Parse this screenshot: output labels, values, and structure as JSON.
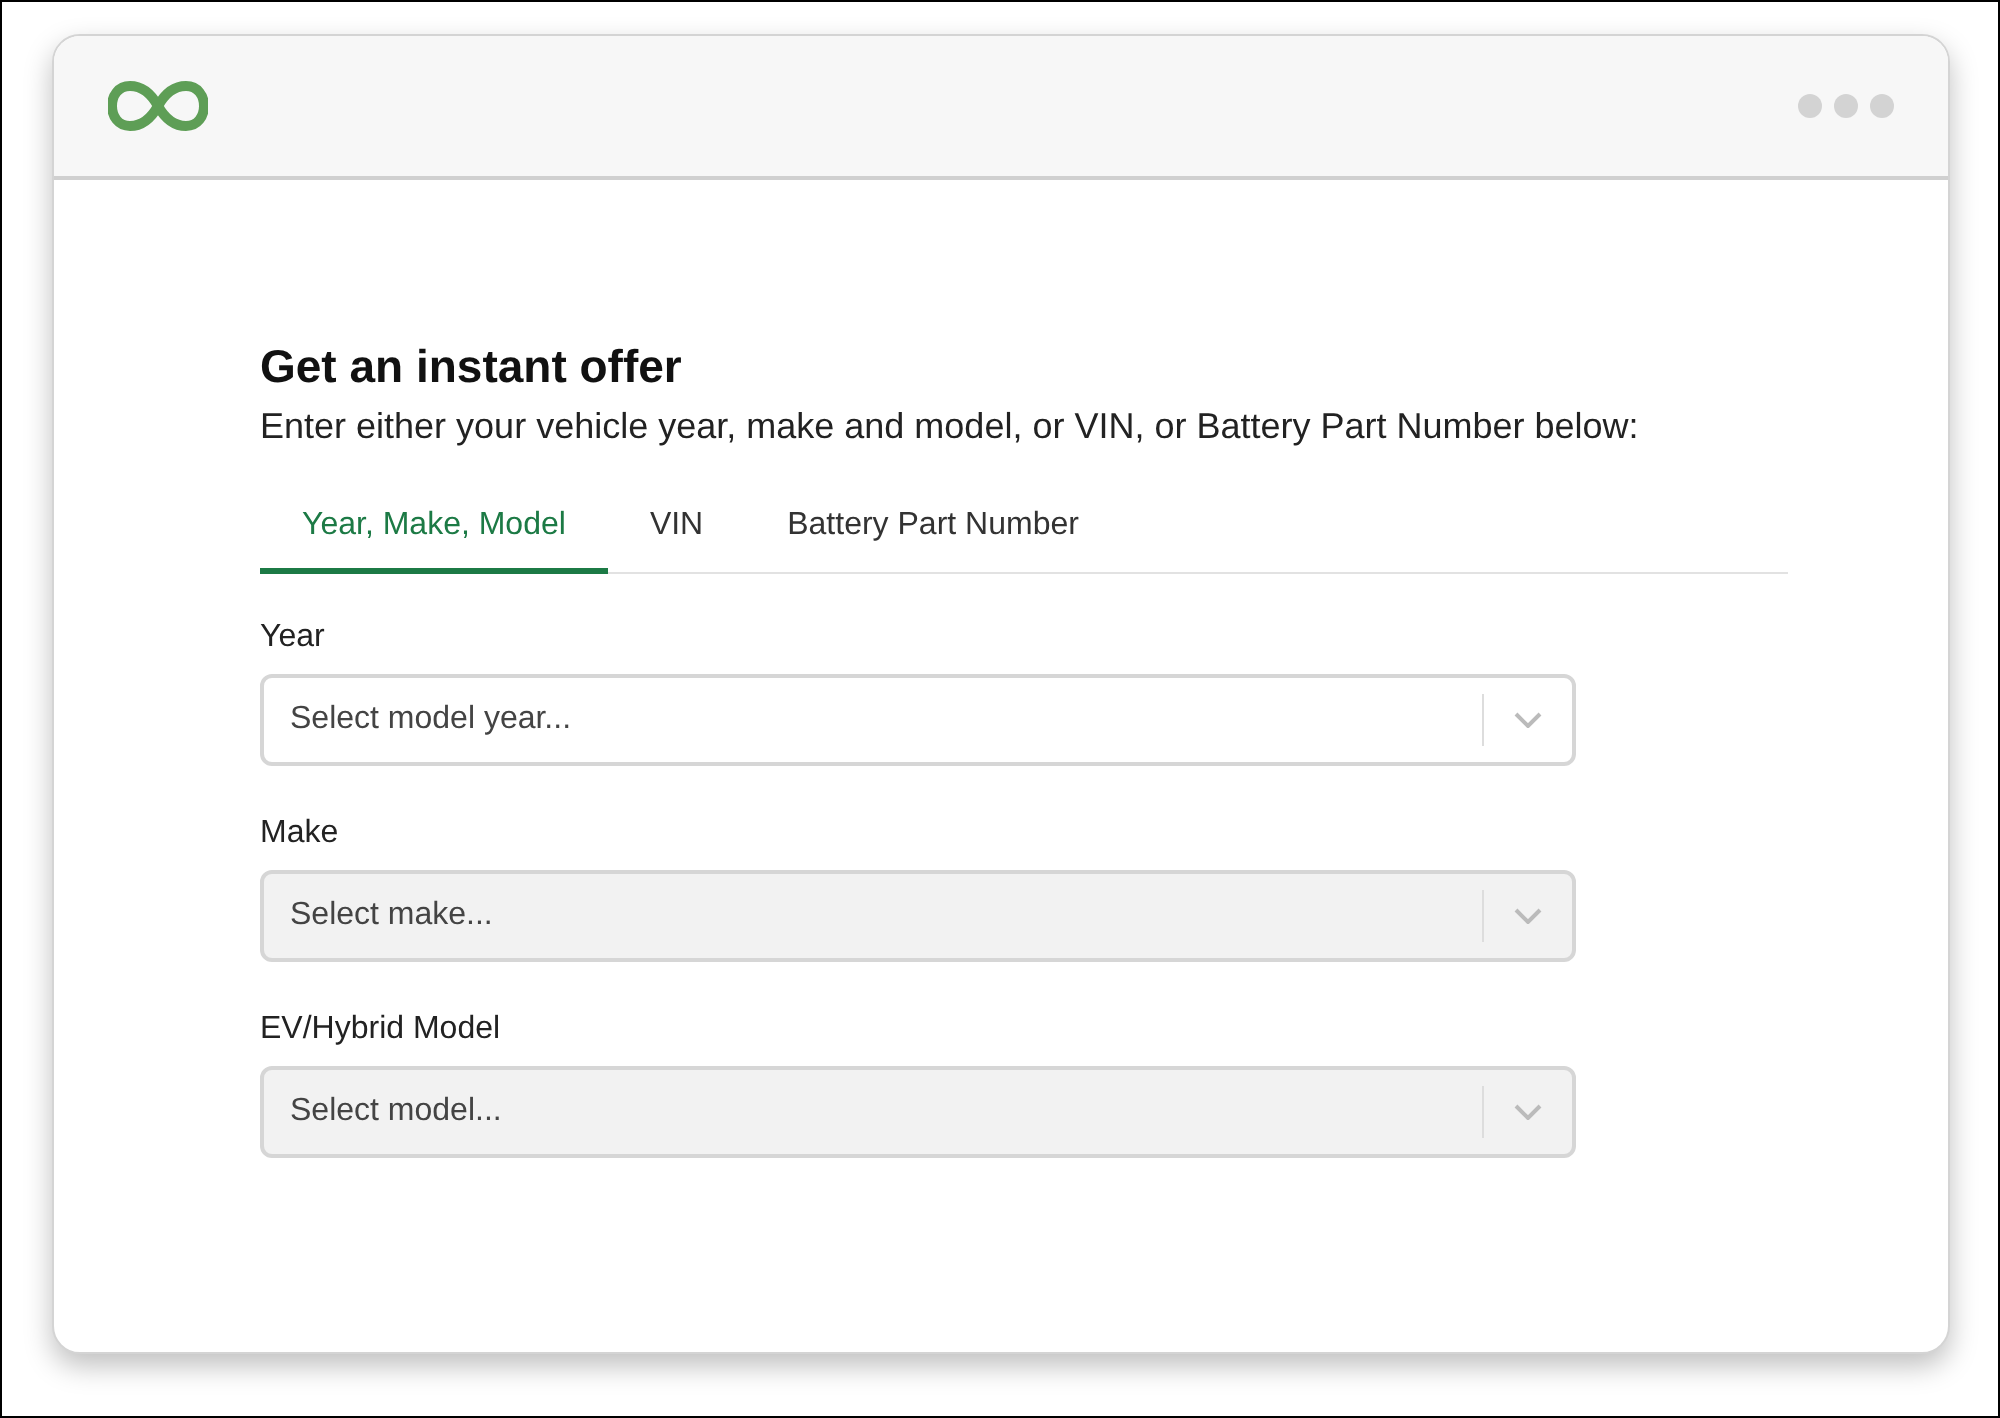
{
  "form": {
    "title": "Get an instant offer",
    "subtitle": "Enter either your vehicle year, make and model, or VIN, or Battery Part Number below:"
  },
  "tabs": [
    {
      "label": "Year, Make, Model",
      "selected": true
    },
    {
      "label": "VIN",
      "selected": false
    },
    {
      "label": "Battery Part Number",
      "selected": false
    }
  ],
  "fields": [
    {
      "label": "Year",
      "placeholder": "Select model year...",
      "disabled": false
    },
    {
      "label": "Make",
      "placeholder": "Select make...",
      "disabled": true
    },
    {
      "label": "EV/Hybrid Model",
      "placeholder": "Select model...",
      "disabled": true
    }
  ]
}
